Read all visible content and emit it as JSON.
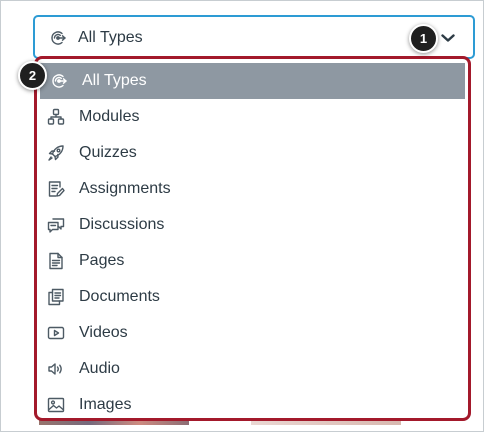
{
  "select": {
    "value": "All Types",
    "icon": "all-types-icon"
  },
  "badges": [
    "1",
    "2"
  ],
  "menu": {
    "items": [
      {
        "label": "All Types",
        "icon": "all-types-icon",
        "selected": true
      },
      {
        "label": "Modules",
        "icon": "modules-icon"
      },
      {
        "label": "Quizzes",
        "icon": "rocket-icon"
      },
      {
        "label": "Assignments",
        "icon": "assignment-icon"
      },
      {
        "label": "Discussions",
        "icon": "discussion-icon"
      },
      {
        "label": "Pages",
        "icon": "page-icon"
      },
      {
        "label": "Documents",
        "icon": "document-icon"
      },
      {
        "label": "Videos",
        "icon": "video-icon"
      },
      {
        "label": "Audio",
        "icon": "audio-icon"
      },
      {
        "label": "Images",
        "icon": "image-icon"
      }
    ]
  },
  "colors": {
    "focus_border": "#2d9bd4",
    "menu_highlight_border": "#a3192b",
    "selected_background": "#8e98a2",
    "text": "#2d3b45",
    "badge": "#1f1f1f"
  }
}
